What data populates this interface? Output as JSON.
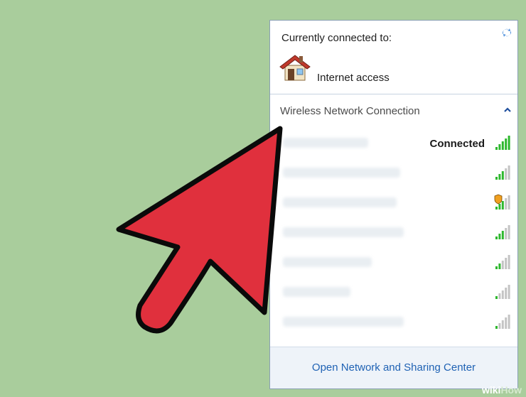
{
  "panel": {
    "connected_title": "Currently connected to:",
    "internet_status": "Internet access",
    "wireless_section": "Wireless Network Connection",
    "networks": [
      {
        "status": "Connected",
        "strength": 5,
        "secured_warning": false,
        "icon": "signal-icon"
      },
      {
        "status": "",
        "strength": 3,
        "secured_warning": false,
        "icon": "signal-icon"
      },
      {
        "status": "",
        "strength": 3,
        "secured_warning": true,
        "icon": "signal-warning-icon"
      },
      {
        "status": "",
        "strength": 3,
        "secured_warning": false,
        "icon": "signal-icon"
      },
      {
        "status": "",
        "strength": 2,
        "secured_warning": false,
        "icon": "signal-icon"
      },
      {
        "status": "",
        "strength": 1,
        "secured_warning": false,
        "icon": "signal-icon"
      },
      {
        "status": "",
        "strength": 1,
        "secured_warning": false,
        "icon": "signal-icon"
      }
    ],
    "open_center": "Open Network and Sharing Center"
  },
  "watermark": {
    "part1": "wiki",
    "part2": "How"
  },
  "colors": {
    "background": "#a9cd9c",
    "arrow": "#e0303d",
    "link": "#1f62b4",
    "signal_active": "#2eb82e",
    "signal_inactive": "#c4c4c4"
  }
}
